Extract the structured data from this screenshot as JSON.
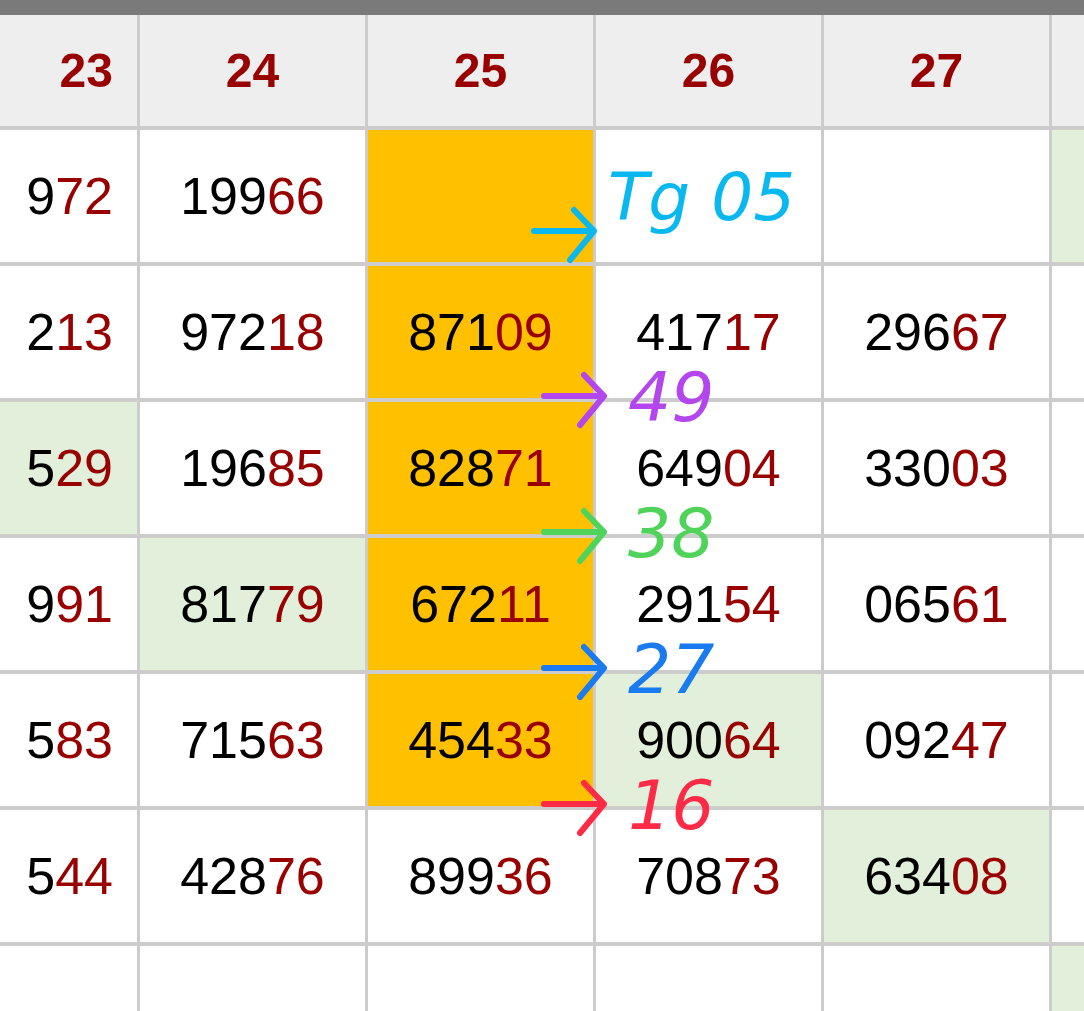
{
  "columns": [
    "23",
    "24",
    "25",
    "26",
    "27",
    ""
  ],
  "rows": [
    {
      "cells": [
        {
          "text": "972"
        },
        {
          "text": "19966"
        },
        {
          "text": "",
          "color": "#ffc000"
        },
        {
          "text": ""
        },
        {
          "text": ""
        },
        {
          "text": "",
          "color": "#e2efda"
        }
      ]
    },
    {
      "cells": [
        {
          "text": "213"
        },
        {
          "text": "97218"
        },
        {
          "text": "87109",
          "color": "#ffc000"
        },
        {
          "text": "41717"
        },
        {
          "text": "29667"
        },
        {
          "text": ""
        }
      ]
    },
    {
      "cells": [
        {
          "text": "529",
          "color": "#e2efda"
        },
        {
          "text": "19685"
        },
        {
          "text": "82871",
          "color": "#ffc000"
        },
        {
          "text": "64904"
        },
        {
          "text": "33003"
        },
        {
          "text": ""
        }
      ]
    },
    {
      "cells": [
        {
          "text": "991"
        },
        {
          "text": "81779",
          "color": "#e2efda"
        },
        {
          "text": "67211",
          "color": "#ffc000"
        },
        {
          "text": "29154"
        },
        {
          "text": "06561"
        },
        {
          "text": ""
        }
      ]
    },
    {
      "cells": [
        {
          "text": "583"
        },
        {
          "text": "71563"
        },
        {
          "text": "45433",
          "color": "#ffc000"
        },
        {
          "text": "90064",
          "color": "#e2efda"
        },
        {
          "text": "09247"
        },
        {
          "text": ""
        }
      ]
    },
    {
      "cells": [
        {
          "text": "544"
        },
        {
          "text": "42876"
        },
        {
          "text": "89936"
        },
        {
          "text": "70873"
        },
        {
          "text": "63408",
          "color": "#e2efda"
        },
        {
          "text": ""
        }
      ]
    },
    {
      "cells": [
        {
          "text": ""
        },
        {
          "text": ""
        },
        {
          "text": ""
        },
        {
          "text": ""
        },
        {
          "text": ""
        },
        {
          "text": "",
          "color": "#e2efda"
        }
      ]
    }
  ],
  "annotations": [
    {
      "text": "Tg 05",
      "color": "#0ab8f0"
    },
    {
      "text": "49",
      "color": "#b446ee"
    },
    {
      "text": "38",
      "color": "#4fd35a"
    },
    {
      "text": "27",
      "color": "#1a7bf0"
    },
    {
      "text": "16",
      "color": "#ff2a45"
    }
  ]
}
